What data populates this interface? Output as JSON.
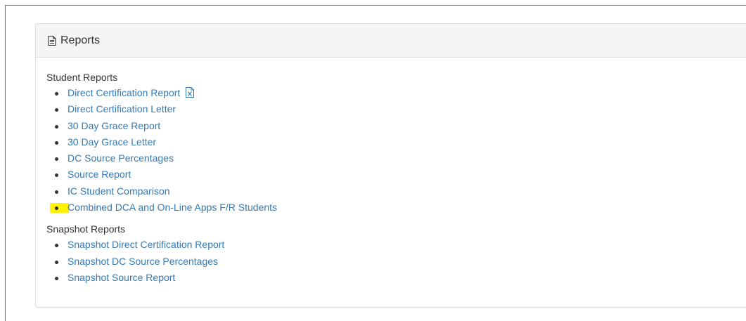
{
  "panel": {
    "title": "Reports",
    "icon": "document-icon"
  },
  "sections": [
    {
      "title": "Student Reports",
      "items": [
        {
          "label": "Direct Certification Report",
          "icon": "excel-file-icon"
        },
        {
          "label": "Direct Certification Letter"
        },
        {
          "label": "30 Day Grace Report"
        },
        {
          "label": "30 Day Grace Letter"
        },
        {
          "label": "DC Source Percentages"
        },
        {
          "label": "Source Report"
        },
        {
          "label": "IC Student Comparison"
        },
        {
          "label": "Combined DCA and On-Line Apps F/R Students",
          "highlight_color": "#fff200"
        }
      ]
    },
    {
      "title": "Snapshot Reports",
      "items": [
        {
          "label": "Snapshot Direct Certification Report"
        },
        {
          "label": "Snapshot DC Source Percentages"
        },
        {
          "label": "Snapshot Source Report"
        }
      ]
    }
  ],
  "colors": {
    "link": "#337ab7",
    "text": "#333333",
    "heading_bg": "#f5f5f5",
    "border": "#dddddd",
    "highlight": "#fff200"
  }
}
